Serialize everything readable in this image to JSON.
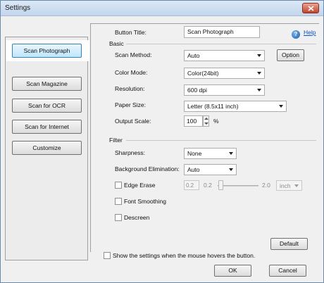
{
  "window": {
    "title": "Settings",
    "close_glyph": "×"
  },
  "nav": {
    "items": [
      {
        "label": "Scan Photograph",
        "selected": true
      },
      {
        "label": "Scan Magazine",
        "selected": false
      },
      {
        "label": "Scan for OCR",
        "selected": false
      },
      {
        "label": "Scan for Internet",
        "selected": false
      },
      {
        "label": "Customize",
        "selected": false
      }
    ]
  },
  "settings": {
    "button_title_label": "Button Title:",
    "button_title_value": "Scan Photograph",
    "help_glyph": "?",
    "help_label": "Help",
    "basic": {
      "section_label": "Basic",
      "scan_method_label": "Scan Method:",
      "scan_method_value": "Auto",
      "option_label": "Option",
      "color_mode_label": "Color Mode:",
      "color_mode_value": "Color(24bit)",
      "resolution_label": "Resolution:",
      "resolution_value": "600 dpi",
      "paper_size_label": "Paper Size:",
      "paper_size_value": "Letter (8.5x11 inch)",
      "output_scale_label": "Output Scale:",
      "output_scale_value": "100",
      "output_scale_unit": "%"
    },
    "filter": {
      "section_label": "Filter",
      "sharpness_label": "Sharpness:",
      "sharpness_value": "None",
      "background_label": "Background Elimination:",
      "background_value": "Auto",
      "edge_erase_label": "Edge Erase",
      "edge_erase_value": "0.2",
      "edge_erase_min": "0.2",
      "edge_erase_max": "2.0",
      "edge_erase_unit": "inch",
      "font_smoothing_label": "Font Smoothing",
      "descreen_label": "Descreen"
    },
    "default_label": "Default"
  },
  "footer": {
    "hover_checkbox_label": "Show the settings when the mouse hovers the button.",
    "ok_label": "OK",
    "cancel_label": "Cancel"
  }
}
